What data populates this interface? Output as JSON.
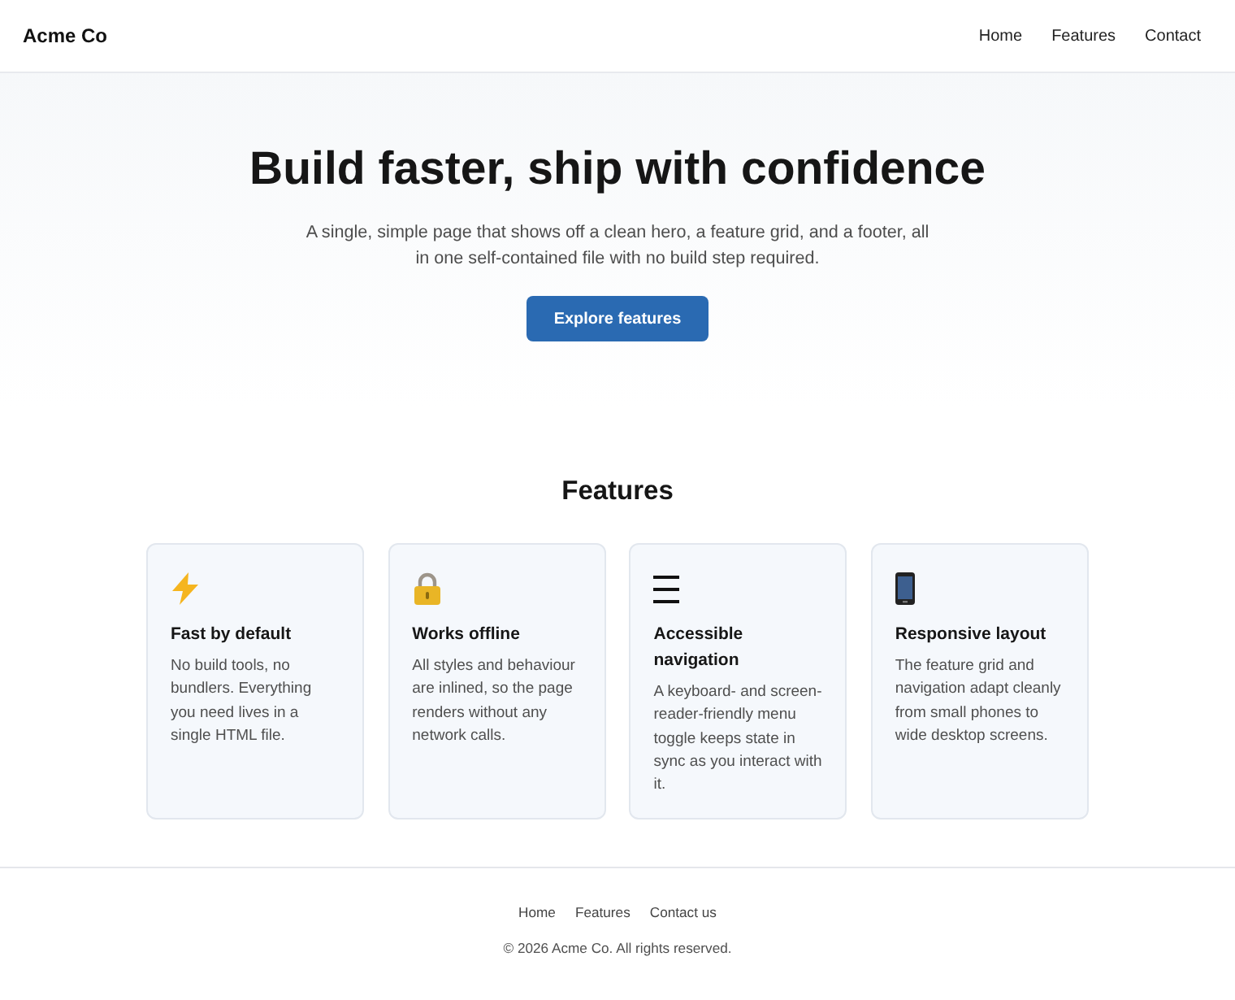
{
  "header": {
    "logo": "Acme Co",
    "nav": [
      "Home",
      "Features",
      "Contact"
    ]
  },
  "hero": {
    "title": "Build faster, ship with confidence",
    "subtitle": "A single, simple page that shows off a clean hero, a feature grid, and a footer, all in one self-contained file with no build step required.",
    "button": "Explore features"
  },
  "features": {
    "heading": "Features",
    "cards": [
      {
        "title": "Fast by default",
        "text": "No build tools, no bundlers. Everything you need lives in a single HTML file."
      },
      {
        "title": "Works offline",
        "text": "All styles and behaviour are inlined, so the page renders without any network calls."
      },
      {
        "title": "Accessible navigation",
        "text": "A keyboard- and screen-reader-friendly menu toggle keeps state in sync as you interact with it."
      },
      {
        "title": "Responsive layout",
        "text": "The feature grid and navigation adapt cleanly from small phones to wide desktop screens."
      }
    ]
  },
  "footer": {
    "links": [
      "Home",
      "Features",
      "Contact us"
    ],
    "copyright": "© 2026 Acme Co. All rights reserved."
  }
}
